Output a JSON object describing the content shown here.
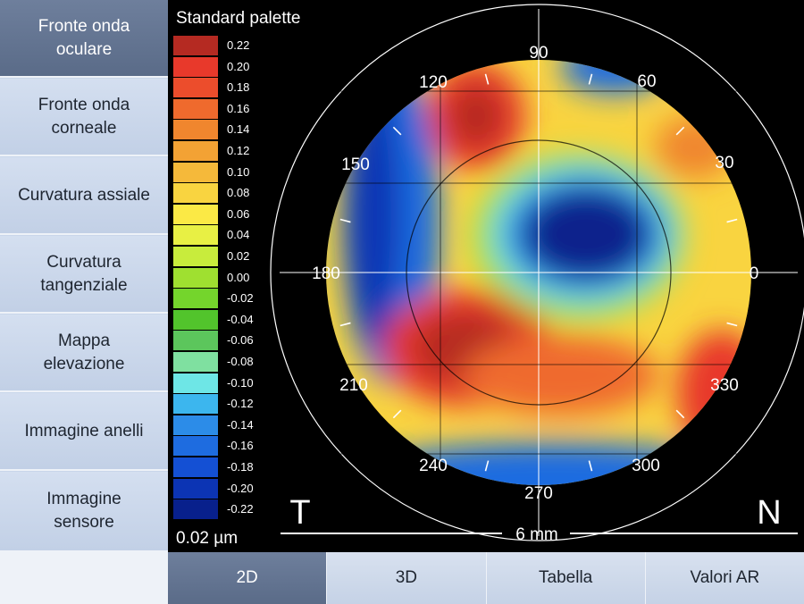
{
  "sidebar": {
    "items": [
      {
        "line1": "Fronte onda",
        "line2": "oculare",
        "active": true
      },
      {
        "line1": "Fronte onda",
        "line2": "corneale"
      },
      {
        "line1": "Curvatura assiale",
        "line2": ""
      },
      {
        "line1": "Curvatura",
        "line2": "tangenziale"
      },
      {
        "line1": "Mappa",
        "line2": "elevazione"
      },
      {
        "line1": "Immagine anelli",
        "line2": ""
      },
      {
        "line1": "Immagine",
        "line2": "sensore"
      }
    ]
  },
  "palette": {
    "title": "Standard palette",
    "step_label": "0.02 µm",
    "levels": [
      {
        "value": "0.22",
        "color": "#b52a22"
      },
      {
        "value": "0.20",
        "color": "#e8392b"
      },
      {
        "value": "0.18",
        "color": "#ec4d2c"
      },
      {
        "value": "0.16",
        "color": "#ef6a2d"
      },
      {
        "value": "0.14",
        "color": "#f0862e"
      },
      {
        "value": "0.12",
        "color": "#f3a234"
      },
      {
        "value": "0.10",
        "color": "#f5b93a"
      },
      {
        "value": "0.08",
        "color": "#f9d440"
      },
      {
        "value": "0.06",
        "color": "#fbe945"
      },
      {
        "value": "0.04",
        "color": "#e8f044"
      },
      {
        "value": "0.02",
        "color": "#c8ec3c"
      },
      {
        "value": "0.00",
        "color": "#9fe030"
      },
      {
        "value": "-0.02",
        "color": "#74d52c"
      },
      {
        "value": "-0.04",
        "color": "#52c42c"
      },
      {
        "value": "-0.06",
        "color": "#5cc65c"
      },
      {
        "value": "-0.08",
        "color": "#7fe0a0"
      },
      {
        "value": "-0.10",
        "color": "#6ee6e6"
      },
      {
        "value": "-0.12",
        "color": "#3cb6ee"
      },
      {
        "value": "-0.14",
        "color": "#2c8ce8"
      },
      {
        "value": "-0.16",
        "color": "#1e6ce0"
      },
      {
        "value": "-0.18",
        "color": "#1450d4"
      },
      {
        "value": "-0.20",
        "color": "#0c34b4"
      },
      {
        "value": "-0.22",
        "color": "#08208c"
      }
    ]
  },
  "map": {
    "angles": [
      "90",
      "60",
      "30",
      "0",
      "330",
      "300",
      "270",
      "240",
      "210",
      "180",
      "150",
      "120"
    ],
    "temporal_label": "T",
    "nasal_label": "N",
    "scale_label": "6 mm"
  },
  "tabs": [
    {
      "label": "2D",
      "active": true
    },
    {
      "label": "3D"
    },
    {
      "label": "Tabella"
    },
    {
      "label": "Valori AR"
    }
  ]
}
